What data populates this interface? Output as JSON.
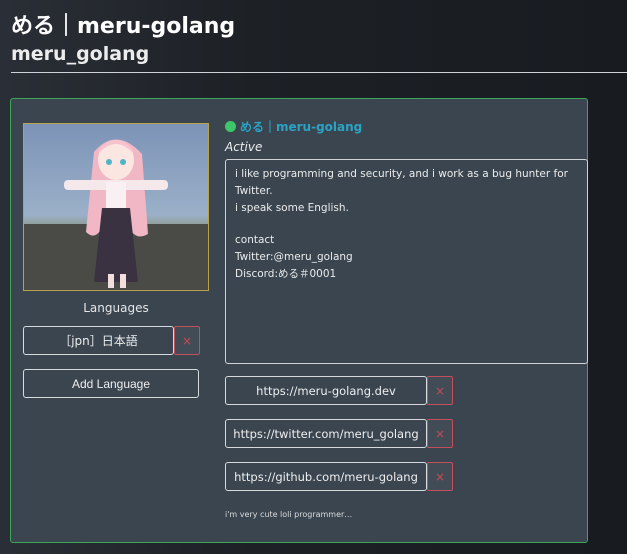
{
  "header": {
    "title": "める｜meru-golang",
    "subtitle": "meru_golang"
  },
  "profile": {
    "languages_label": "Languages",
    "language": "［jpn］日本語",
    "remove_label": "×",
    "add_language_label": "Add Language",
    "display_name": "める｜meru-golang",
    "status": "Active",
    "status_color": "#3ec66a",
    "name_color": "#2aa3c4",
    "bio_lines": [
      "i like programming and security, and i work as a bug hunter for Twitter.",
      "i speak some English.",
      "",
      "contact",
      "Twitter:@meru_golang",
      "Discord:める＃0001"
    ],
    "links": [
      "https://meru-golang.dev",
      "https://twitter.com/meru_golang",
      "https://github.com/meru-golang"
    ],
    "footer_note": "i'm very cute loli programmer…"
  }
}
